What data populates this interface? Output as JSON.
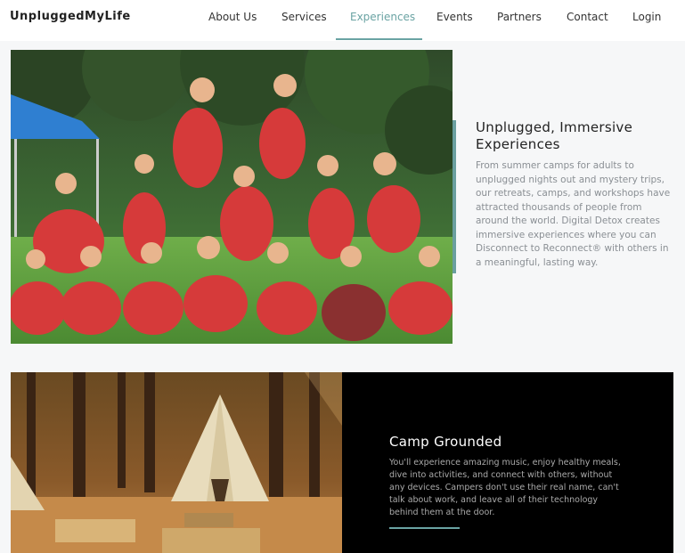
{
  "header": {
    "logo": "UnpluggedMyLife",
    "nav": [
      {
        "label": "About Us"
      },
      {
        "label": "Services"
      },
      {
        "label": "Experiences"
      },
      {
        "label": "Events"
      },
      {
        "label": "Partners"
      },
      {
        "label": "Contact"
      },
      {
        "label": "Login"
      }
    ],
    "active_item": "Experiences"
  },
  "section_immersive": {
    "title": "Unplugged, Immersive Experiences",
    "body": "From summer camps for adults to unplugged nights out and mystery trips, our retreats, camps, and workshops have attracted thousands of people from around the world. Digital Detox creates immersive experiences where you can Disconnect to Reconnect® with others in a meaningful, lasting way."
  },
  "section_camp": {
    "title": "Camp Grounded",
    "body": "You'll experience amazing music, enjoy healthy meals, dive into activities, and connect with others, without any devices. Campers don't use their real name, can't talk about work, and leave all of their technology behind them at the door."
  },
  "colors": {
    "accent": "#6aa3a3",
    "page_background": "#f6f7f8",
    "dark_panel": "#000000"
  }
}
